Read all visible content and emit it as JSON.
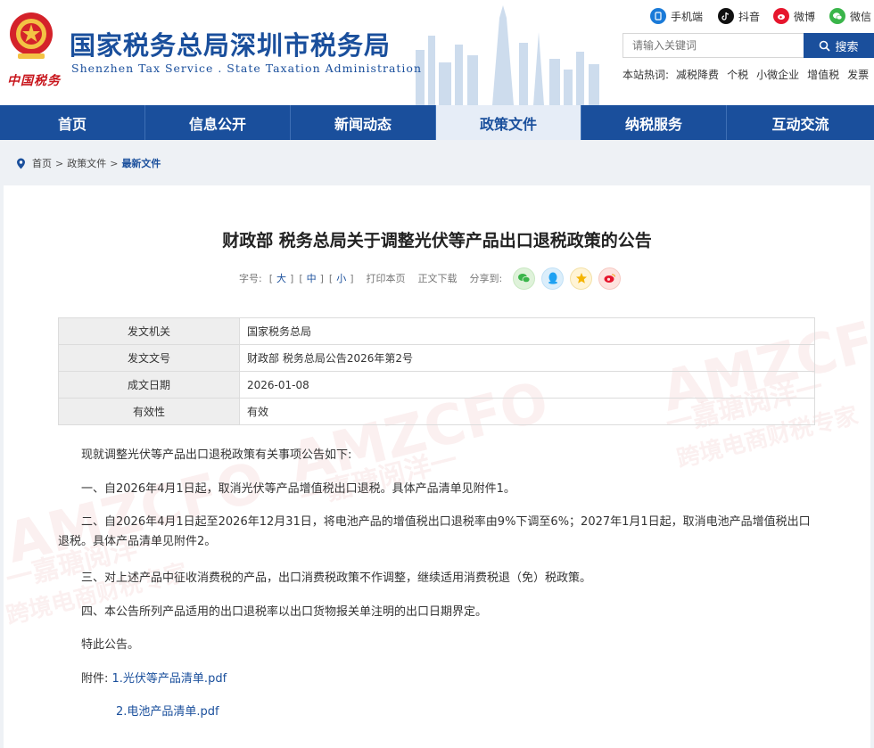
{
  "site": {
    "title": "国家税务总局深圳市税务局",
    "subtitle": "Shenzhen Tax Service . State Taxation Administration",
    "mark": "中国税务"
  },
  "social": [
    {
      "label": "手机端",
      "icon": "mobile-icon",
      "color": "#1a7ad8"
    },
    {
      "label": "抖音",
      "icon": "douyin-icon",
      "color": "#111111"
    },
    {
      "label": "微博",
      "icon": "weibo-icon",
      "color": "#e6162d"
    },
    {
      "label": "微信",
      "icon": "wechat-icon",
      "color": "#3ab54a"
    }
  ],
  "search": {
    "placeholder": "请输入关键词",
    "button": "搜索"
  },
  "hot": {
    "label": "本站热词:",
    "items": [
      "减税降费",
      "个税",
      "小微企业",
      "增值税",
      "发票"
    ]
  },
  "nav": {
    "items": [
      "首页",
      "信息公开",
      "新闻动态",
      "政策文件",
      "纳税服务",
      "互动交流"
    ],
    "active": "政策文件"
  },
  "breadcrumb": {
    "items": [
      "首页",
      "政策文件",
      "最新文件"
    ],
    "sep": ">"
  },
  "article": {
    "title": "财政部 税务总局关于调整光伏等产品出口退税政策的公告",
    "font_label": "字号:",
    "size_large": "大",
    "size_medium": "中",
    "size_small": "小",
    "print": "打印本页",
    "download": "正文下载",
    "share": "分享到:"
  },
  "meta": [
    {
      "key": "发文机关",
      "value": "国家税务总局"
    },
    {
      "key": "发文文号",
      "value": "财政部 税务总局公告2026年第2号"
    },
    {
      "key": "成文日期",
      "value": "2026-01-08"
    },
    {
      "key": "有效性",
      "value": "有效"
    }
  ],
  "body": {
    "intro": "现就调整光伏等产品出口退税政策有关事项公告如下:",
    "p1": "一、自2026年4月1日起，取消光伏等产品增值税出口退税。具体产品清单见附件1。",
    "p2": "二、自2026年4月1日起至2026年12月31日，将电池产品的增值税出口退税率由9%下调至6%；2027年1月1日起，取消电池产品增值税出口退税。具体产品清单见附件2。",
    "p3": "三、对上述产品中征收消费税的产品，出口消费税政策不作调整，继续适用消费税退（免）税政策。",
    "p4": "四、本公告所列产品适用的出口退税率以出口货物报关单注明的出口日期界定。",
    "closing": "特此公告。",
    "attach_label": "附件:",
    "attach1": "1.光伏等产品清单.pdf",
    "attach2": "2.电池产品清单.pdf"
  },
  "watermark": {
    "brand": "AMZCFO",
    "line1": "一嘉瑭阅洋一",
    "line2": "跨境电商财税专家"
  },
  "colors": {
    "brand_blue": "#1a4f9c",
    "nav_active_bg": "#e6edf7",
    "table_key_bg": "#eeeeee"
  }
}
